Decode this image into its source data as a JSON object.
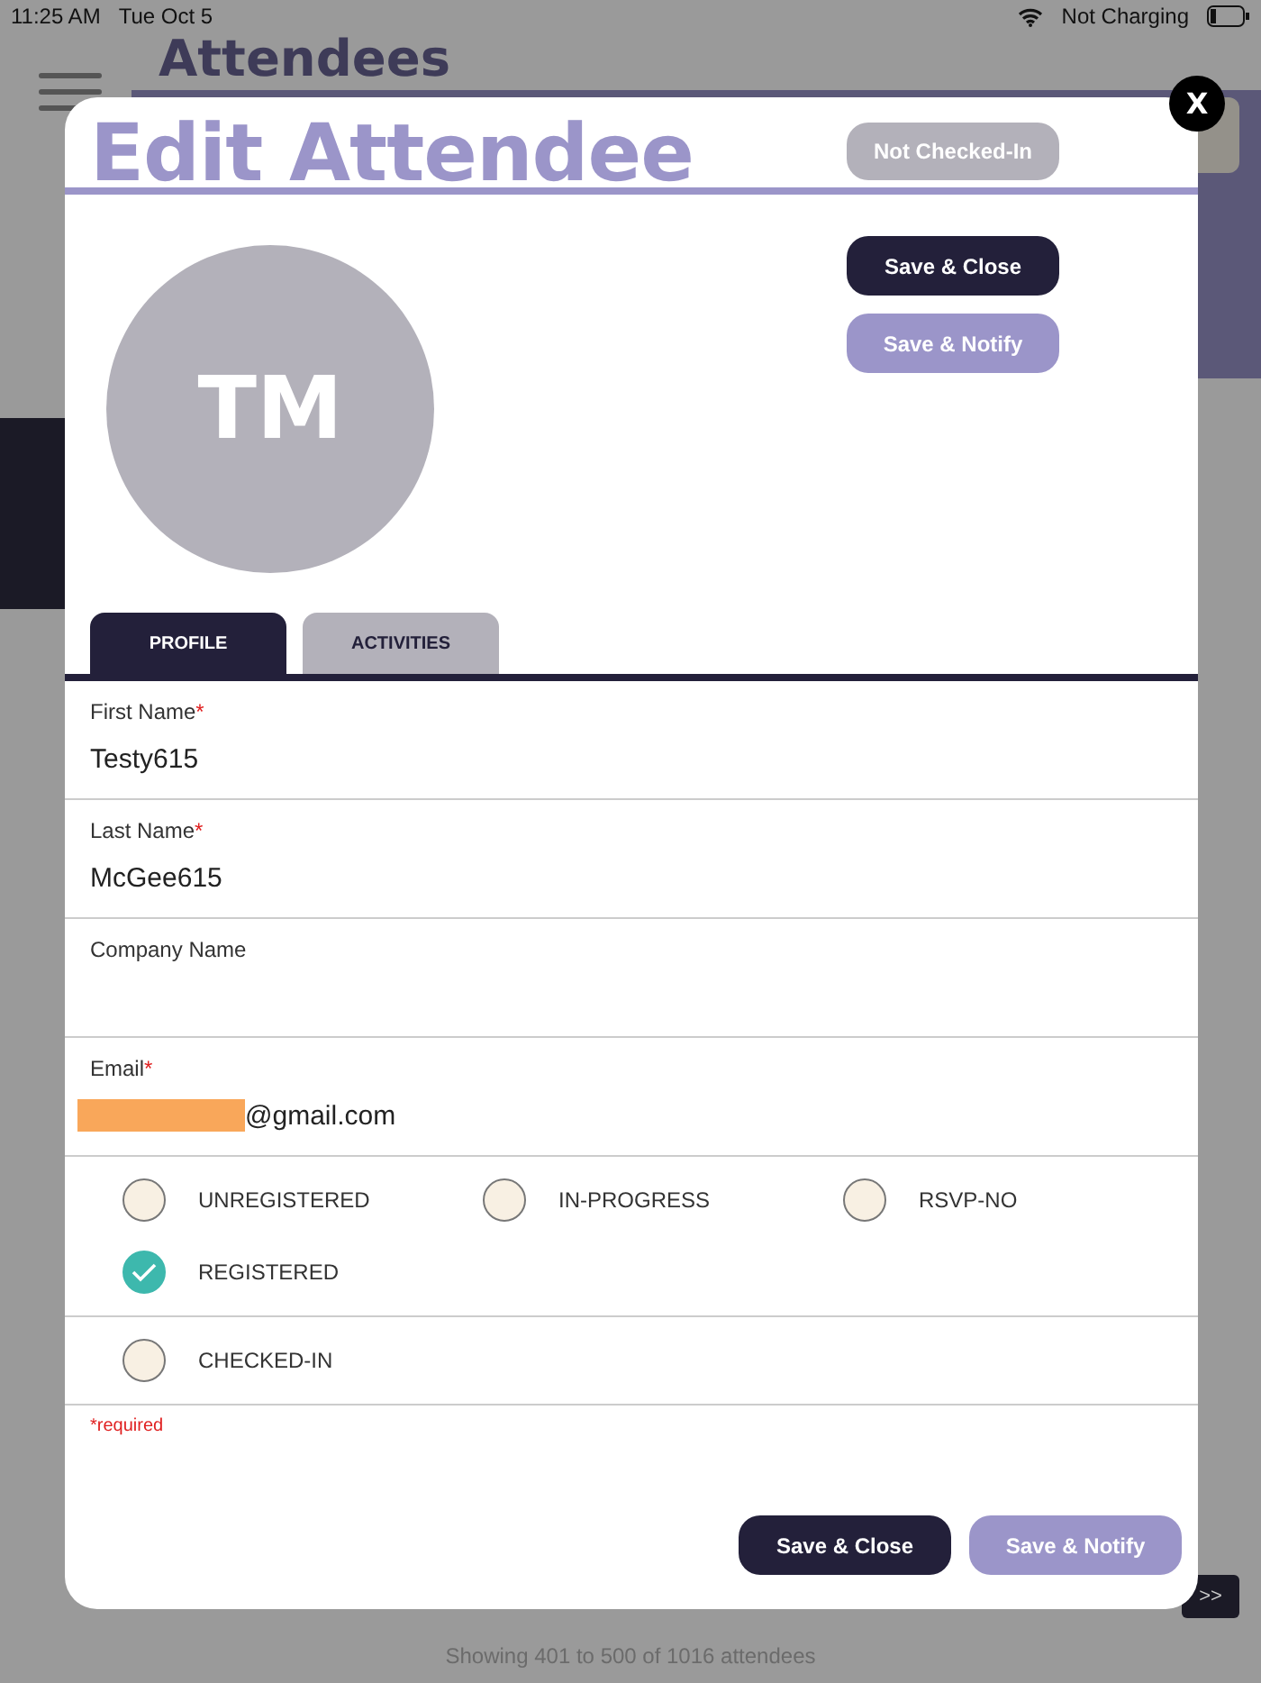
{
  "status_bar": {
    "time": "11:25 AM",
    "date": "Tue Oct 5",
    "charging": "Not Charging"
  },
  "background": {
    "title": "Attendees",
    "footer": "Showing 401 to 500 of 1016 attendees",
    "next_page": ">>"
  },
  "modal": {
    "title": "Edit Attendee",
    "check_status": "Not Checked-In",
    "close": "X",
    "avatar_initials": "TM",
    "top_buttons": [
      {
        "label": "Save & Close",
        "kind": "primary"
      },
      {
        "label": "Save & Notify",
        "kind": "secondary"
      }
    ],
    "tabs": [
      {
        "label": "PROFILE",
        "selected": true
      },
      {
        "label": "ACTIVITIES",
        "selected": false
      }
    ],
    "fields": [
      {
        "label": "First Name",
        "required_mark": "*",
        "value": "Testy615"
      },
      {
        "label": "Last Name",
        "required_mark": "*",
        "value": "McGee615"
      },
      {
        "label": "Company Name"
      },
      {
        "label": "Email",
        "required_mark": "*",
        "value": "@gmail.com",
        "redacted": true
      }
    ],
    "statuses": [
      {
        "label": "UNREGISTERED",
        "selected": false
      },
      {
        "label": "IN-PROGRESS",
        "selected": false
      },
      {
        "label": "RSVP-NO",
        "selected": false
      },
      {
        "label": "REGISTERED",
        "selected": true
      }
    ],
    "checked_in": {
      "label": "CHECKED-IN",
      "checked": false
    },
    "required_note": "*required",
    "bottom_buttons": [
      {
        "label": "Save & Close",
        "kind": "primary"
      },
      {
        "label": "Save & Notify",
        "kind": "secondary"
      }
    ]
  }
}
